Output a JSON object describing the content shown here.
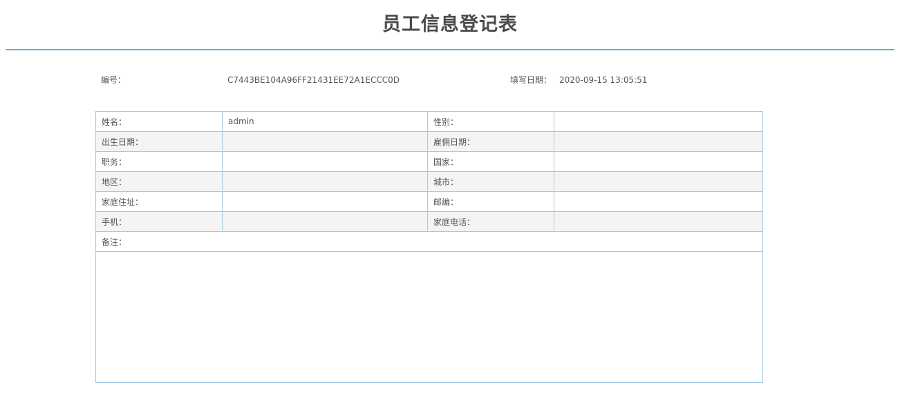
{
  "page": {
    "title": "员工信息登记表"
  },
  "meta": {
    "number_label": "编号：",
    "number_value": "C7443BE104A96FF21431EE72A1ECCC0D",
    "date_label": "填写日期：",
    "date_value": "2020-09-15 13:05:51"
  },
  "rows": [
    {
      "label1": "姓名：",
      "value1": "admin",
      "label2": "性别：",
      "value2": ""
    },
    {
      "label1": "出生日期：",
      "value1": "",
      "label2": "雇佣日期：",
      "value2": ""
    },
    {
      "label1": "职务：",
      "value1": "",
      "label2": "国家：",
      "value2": ""
    },
    {
      "label1": "地区：",
      "value1": "",
      "label2": "城市：",
      "value2": ""
    },
    {
      "label1": "家庭住址：",
      "value1": "",
      "label2": "邮编：",
      "value2": ""
    },
    {
      "label1": "手机：",
      "value1": "",
      "label2": "家庭电话：",
      "value2": ""
    }
  ],
  "remark": {
    "label": "备注：",
    "value": ""
  }
}
